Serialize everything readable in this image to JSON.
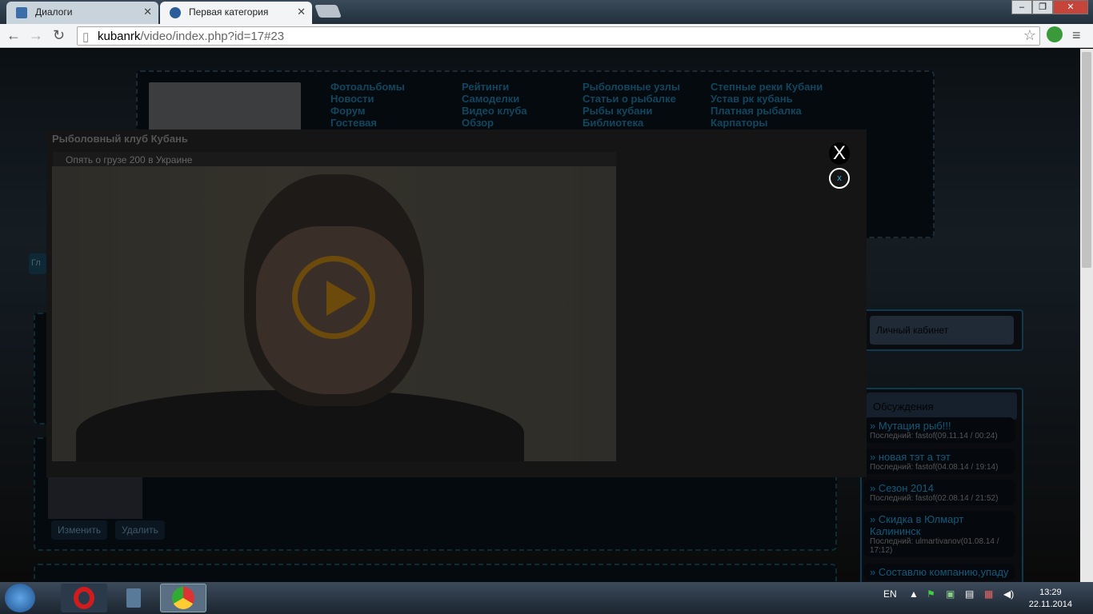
{
  "browser": {
    "tabs": [
      {
        "label": "Диалоги"
      },
      {
        "label": "Первая категория"
      }
    ],
    "url_host": "kubanrk",
    "url_path": "/video/index.php?id=17#23"
  },
  "page": {
    "menu": [
      [
        "Фотоальбомы",
        "Новости",
        "Форум",
        "Гостевая"
      ],
      [
        "Рейтинги",
        "Самоделки",
        "Видео клуба",
        "Обзор"
      ],
      [
        "Рыболовные узлы",
        "Статьи о рыбалке",
        "Рыбы кубани",
        "Библиотека"
      ],
      [
        "Степные реки Кубани",
        "Устав рк кубань",
        "Платная рыбалка",
        "Карпаторы"
      ]
    ],
    "personal_cabinet": "Личный кабинет",
    "discussions_title": "Обсуждения",
    "discussions": [
      {
        "title": "» Мутация рыб!!!",
        "meta": "Последний: fastof(09.11.14 / 00:24)"
      },
      {
        "title": "» новая тэт а тэт",
        "meta": "Последний: fastof(04.08.14 / 19:14)"
      },
      {
        "title": "» Сезон 2014",
        "meta": "Последний: fastof(02.08.14 / 21:52)"
      },
      {
        "title": "» Скидка в Юлмарт Калининск",
        "meta": "Последний: ulmartivanov(01.08.14 / 17:12)"
      },
      {
        "title": "» Составлю компанию,упаду",
        "meta": ""
      }
    ],
    "edit_label": "Изменить",
    "delete_label": "Удалить",
    "home_tab": "Гл"
  },
  "modal": {
    "title": "Рыболовный клуб Кубань",
    "video_title": "Опять о грузе 200 в Украине",
    "close": "X",
    "close_small": "x"
  },
  "taskbar": {
    "lang": "EN",
    "time": "13:29",
    "date": "22.11.2014"
  }
}
